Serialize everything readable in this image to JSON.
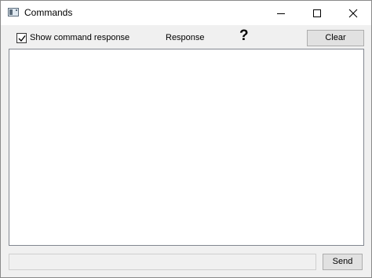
{
  "window": {
    "title": "Commands",
    "icons": {
      "app": "app-window-icon",
      "minimize": "minimize-icon",
      "maximize": "maximize-icon",
      "close": "close-icon"
    }
  },
  "toolbar": {
    "show_response_label": "Show command response",
    "show_response_checked": true,
    "response_label": "Response",
    "help_glyph": "?",
    "clear_label": "Clear"
  },
  "response": {
    "text": ""
  },
  "command": {
    "value": "",
    "placeholder": "",
    "send_label": "Send"
  }
}
